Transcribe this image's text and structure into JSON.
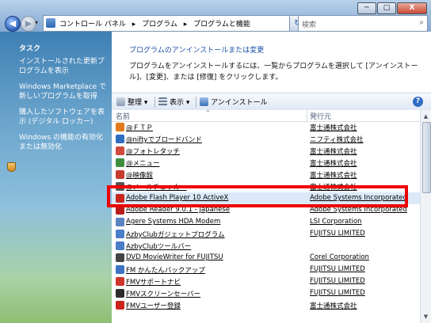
{
  "window": {
    "minimize": "─",
    "maximize": "□",
    "close": "X"
  },
  "address": {
    "crumbs": [
      "コントロール パネル",
      "▸",
      "プログラム",
      "▸",
      "プログラムと機能"
    ],
    "search_placeholder": "検索"
  },
  "tasks": {
    "title": "タスク",
    "links": [
      "インストールされた更新プログラムを表示",
      "Windows Marketplace で新しいプログラムを取得",
      "購入したソフトウェアを表示 (デジタル ロッカー)",
      "Windows の機能の有効化または無効化"
    ]
  },
  "main": {
    "title": "プログラムのアンインストールまたは変更",
    "desc": "プログラムをアンインストールするには、一覧からプログラムを選択して [アンインストール]、[変更]、または [修復] をクリックします。"
  },
  "toolbar": {
    "organize": "整理 ▾",
    "view": "表示 ▾",
    "uninstall": "アンインストール",
    "help": "?"
  },
  "columns": {
    "name": "名前",
    "publisher": "発行元"
  },
  "programs": [
    {
      "name": "@ＦＴＰ",
      "publisher": "富士通株式会社",
      "color": "#e07a1b"
    },
    {
      "name": "@niftyでブロードバンド",
      "publisher": "ニフティ株式会社",
      "color": "#2f6dc2"
    },
    {
      "name": "@フォトレタッチ",
      "publisher": "富士通株式会社",
      "color": "#d24a3b"
    },
    {
      "name": "@メニュー",
      "publisher": "富士通株式会社",
      "color": "#3d8f3d"
    },
    {
      "name": "@映像館",
      "publisher": "富士通株式会社",
      "color": "#c73b2e"
    },
    {
      "name": "@メールチェッカー",
      "publisher": "富士通株式会社",
      "color": "#555555"
    },
    {
      "name": "Adobe Flash Player 10 ActiveX",
      "publisher": "Adobe Systems Incorporated",
      "color": "#c8261d"
    },
    {
      "name": "Adobe Reader 9.0.1 - Japanese",
      "publisher": "Adobe Systems Incorporated",
      "color": "#b81c1c"
    },
    {
      "name": "Agere Systems HDA Modem",
      "publisher": "LSI Corporation",
      "color": "#5a84c4"
    },
    {
      "name": "AzbyClubガジェットプログラム",
      "publisher": "FUJITSU LIMITED",
      "color": "#4a7dc7"
    },
    {
      "name": "AzbyClubツールバー",
      "publisher": "",
      "color": "#4a7dc7"
    },
    {
      "name": "DVD MovieWriter for FUJITSU",
      "publisher": "Corel Corporation",
      "color": "#444444"
    },
    {
      "name": "FM かんたんバックアップ",
      "publisher": "FUJITSU LIMITED",
      "color": "#3b74c2"
    },
    {
      "name": "FMVサポートナビ",
      "publisher": "FUJITSU LIMITED",
      "color": "#d0352b"
    },
    {
      "name": "FMVスクリーンセーバー",
      "publisher": "FUJITSU LIMITED",
      "color": "#2c2c2c"
    },
    {
      "name": "FMVユーザー登録",
      "publisher": "富士通株式会社",
      "color": "#c8261d"
    }
  ]
}
